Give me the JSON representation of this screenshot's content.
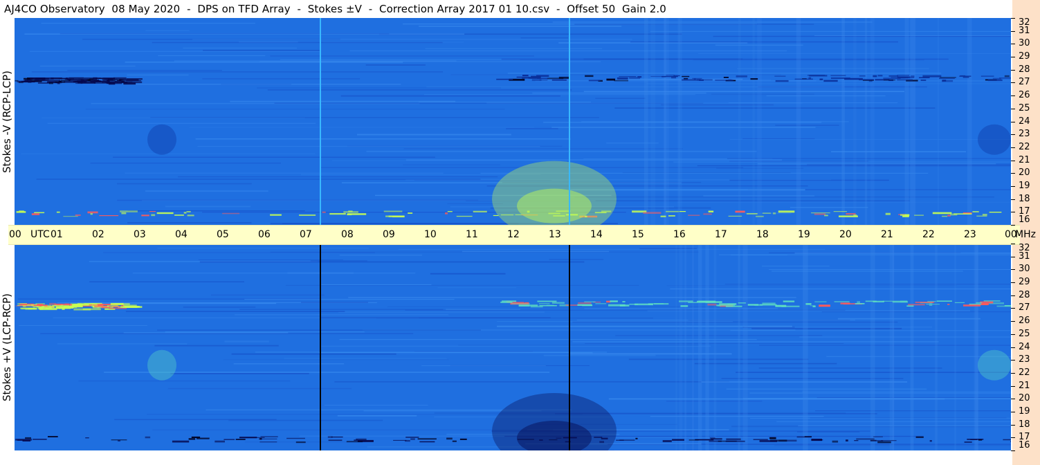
{
  "title": "AJ4CO Observatory  08 May 2020  -  DPS on TFD Array  -  Stokes ±V  -  Correction Array 2017 01 10.csv  -  Offset 50  Gain 2.0",
  "colors": {
    "background_field": "#1f6fe0",
    "time_axis_bg": "#ffffc8",
    "freq_axis_bg": "#fde1c8",
    "hot": "#c8ff50",
    "cold": "#05084d"
  },
  "chart_data": [
    {
      "type": "heatmap",
      "panel": "top",
      "ylabel": "Stokes -V (RCP-LCP)",
      "xlabel": "UTC",
      "xlim": [
        0,
        24
      ],
      "ylim": [
        16,
        32
      ],
      "y_unit": "MHz",
      "yticks": [
        "32",
        "31",
        "30",
        "29",
        "28",
        "27",
        "26",
        "25",
        "24",
        "23",
        "22",
        "21",
        "20",
        "19",
        "18",
        "17",
        "16"
      ],
      "xticks": [
        "00",
        "01",
        "02",
        "03",
        "04",
        "05",
        "06",
        "07",
        "08",
        "09",
        "10",
        "11",
        "12",
        "13",
        "14",
        "15",
        "16",
        "17",
        "18",
        "19",
        "20",
        "21",
        "22",
        "23",
        "00"
      ],
      "markers_utc": [
        7.35,
        13.35
      ],
      "features": [
        {
          "kind": "cold_band",
          "freq_mhz": 27.2,
          "utc_start": 0.0,
          "utc_end": 2.7,
          "intensity": 0.9
        },
        {
          "kind": "hot_band",
          "freq_mhz": 16.9,
          "utc_start": 0.0,
          "utc_end": 24.0,
          "intensity": 0.8
        },
        {
          "kind": "cold_band",
          "freq_mhz": 27.4,
          "utc_start": 11.5,
          "utc_end": 24.0,
          "intensity": 0.7
        },
        {
          "kind": "hot_patch",
          "freq_mhz": 18.0,
          "utc_start": 11.5,
          "utc_end": 14.5,
          "intensity": 0.8
        },
        {
          "kind": "cold_spot",
          "freq_mhz": 22.6,
          "utc_start": 3.2,
          "utc_end": 3.9,
          "intensity": 0.7
        },
        {
          "kind": "cold_spot",
          "freq_mhz": 22.6,
          "utc_start": 23.2,
          "utc_end": 24.0,
          "intensity": 0.6
        }
      ]
    },
    {
      "type": "heatmap",
      "panel": "bottom",
      "ylabel": "Stokes +V (LCP-RCP)",
      "xlabel": "UTC",
      "xlim": [
        0,
        24
      ],
      "ylim": [
        16,
        32
      ],
      "y_unit": "MHz",
      "yticks": [
        "32",
        "31",
        "30",
        "29",
        "28",
        "27",
        "26",
        "25",
        "24",
        "23",
        "22",
        "21",
        "20",
        "19",
        "18",
        "17",
        "16"
      ],
      "markers_utc": [
        7.35,
        13.35
      ],
      "features": [
        {
          "kind": "hot_band",
          "freq_mhz": 27.2,
          "utc_start": 0.0,
          "utc_end": 2.7,
          "intensity": 0.9
        },
        {
          "kind": "cold_band",
          "freq_mhz": 16.9,
          "utc_start": 0.0,
          "utc_end": 24.0,
          "intensity": 0.8
        },
        {
          "kind": "hot_band",
          "freq_mhz": 27.4,
          "utc_start": 11.5,
          "utc_end": 24.0,
          "intensity": 0.6
        },
        {
          "kind": "cold_patch",
          "freq_mhz": 17.5,
          "utc_start": 11.5,
          "utc_end": 14.5,
          "intensity": 0.9
        },
        {
          "kind": "hot_spot",
          "freq_mhz": 22.6,
          "utc_start": 3.2,
          "utc_end": 3.9,
          "intensity": 0.5
        },
        {
          "kind": "hot_spot",
          "freq_mhz": 22.6,
          "utc_start": 23.2,
          "utc_end": 24.0,
          "intensity": 0.5
        }
      ]
    }
  ],
  "axis": {
    "utc_label": "UTC",
    "mhz_label": "MHz"
  }
}
